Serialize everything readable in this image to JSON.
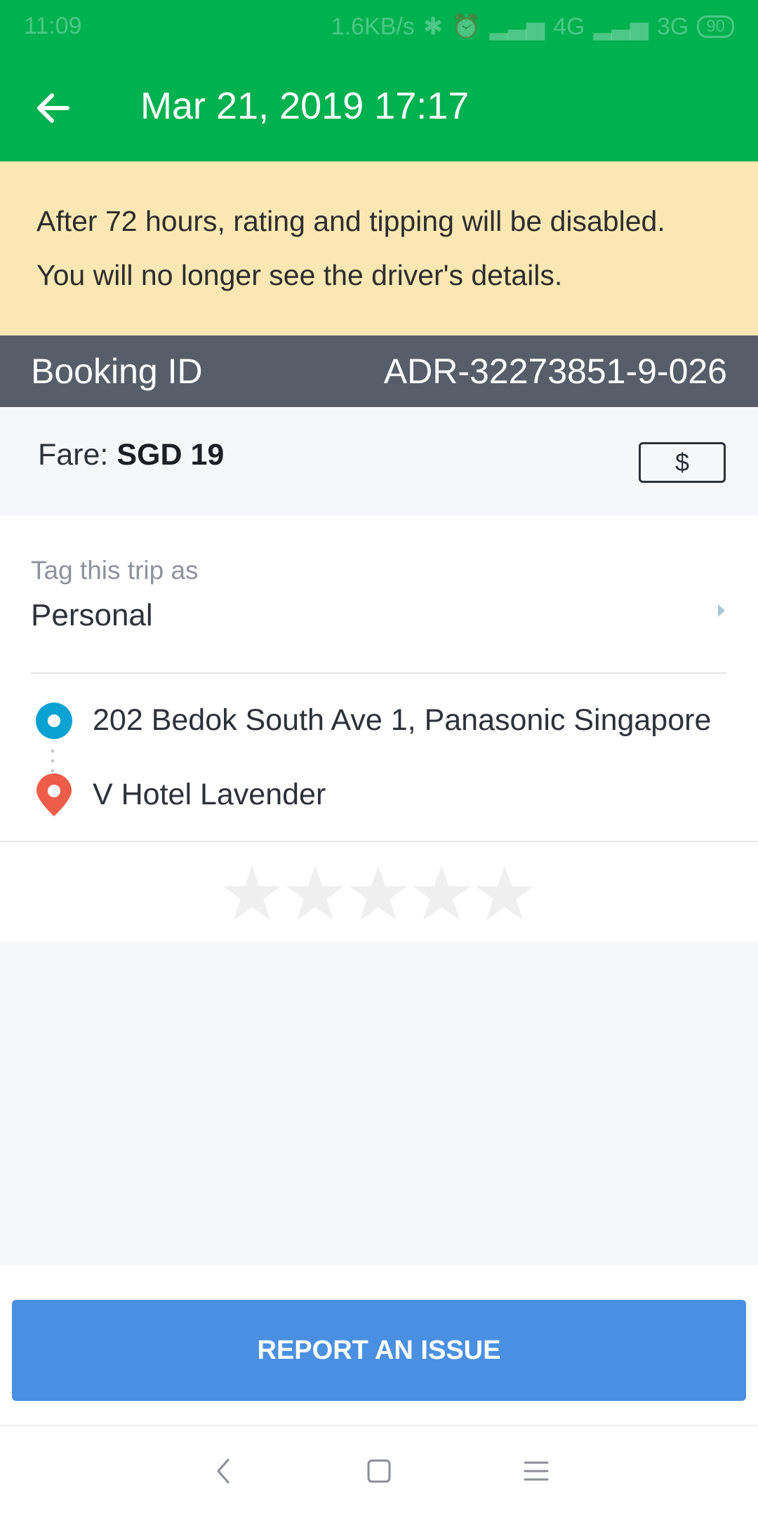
{
  "status_bar": {
    "time": "11:09",
    "network_speed": "1.6KB/s",
    "net_4g": "4G",
    "net_3g": "3G",
    "battery": "90"
  },
  "header": {
    "title": "Mar 21, 2019 17:17",
    "background": "#00b14f"
  },
  "notice": {
    "line1": "After 72 hours, rating and tipping will be disabled.",
    "line2": "You will no longer see the driver's details."
  },
  "booking": {
    "label": "Booking ID",
    "value": "ADR-32273851-9-026"
  },
  "fare": {
    "label": "Fare: ",
    "amount": "SGD 19",
    "payment_symbol": "$"
  },
  "trip_tag": {
    "label": "Tag this trip as",
    "value": "Personal"
  },
  "route": {
    "pickup": "202 Bedok South Ave 1, Panasonic Singapore",
    "dropoff": "V Hotel Lavender",
    "pickup_color": "#0aa2d2",
    "dropoff_color": "#ee5d4a"
  },
  "rating": {
    "max_stars": 5,
    "selected": 0
  },
  "actions": {
    "report_label": "REPORT AN ISSUE",
    "report_color": "#4a90e2"
  },
  "nav": {
    "icons": [
      "back-icon",
      "home-icon",
      "menu-icon"
    ]
  }
}
